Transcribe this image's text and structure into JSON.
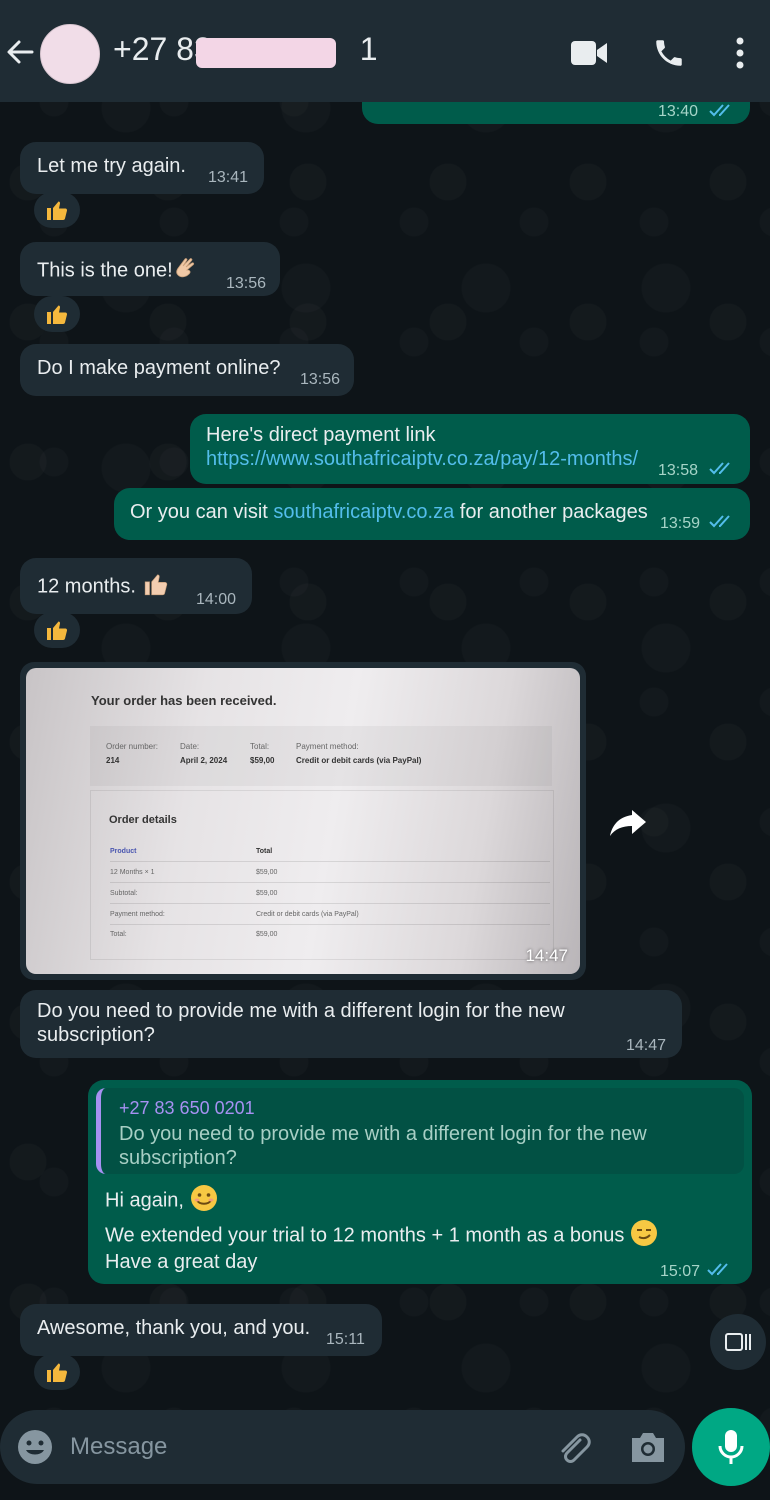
{
  "header": {
    "contact_name": "+27 83",
    "contact_suffix": "1"
  },
  "messages": {
    "m0_time": "13:40",
    "m1_text": "Let me try again.",
    "m1_time": "13:41",
    "m2_text": "This is the one!",
    "m2_time": "13:56",
    "m3_text": "Do I make payment online?",
    "m3_time": "13:56",
    "m4_line1": "Here's  direct payment link",
    "m4_link": "https://www.southafricaiptv.co.za/pay/12-months/",
    "m4_time": "13:58",
    "m5_pre": "Or you can visit ",
    "m5_link": "southafricaiptv.co.za",
    "m5_post": " for another packages",
    "m5_time": "13:59",
    "m6_text": "12 months.",
    "m6_time": "14:00",
    "m8_text": "Do you need to provide me with a different login for the new subscription?",
    "m8_time": "14:47",
    "m9_quote_name": "+27 83 650 0201",
    "m9_quote_text": "Do you need to provide me with a different login for the new subscription?",
    "m9_line1": "Hi again,",
    "m9_line2": "We extended your trial to 12 months + 1 month as a bonus",
    "m9_line3": "Have a great day",
    "m9_time": "15:07",
    "m10_text": "Awesome, thank you, and you.",
    "m10_time": "15:11"
  },
  "image_message": {
    "time": "14:47",
    "order_title": "Your order has been received.",
    "order_number_label": "Order number:",
    "order_number": "214",
    "date_label": "Date:",
    "date": "April 2, 2024",
    "total_label": "Total:",
    "total": "$59,00",
    "payment_method_label": "Payment method:",
    "payment_method": "Credit or debit cards (via PayPal)",
    "order_details": "Order details",
    "col_product": "Product",
    "col_total": "Total",
    "row1_label": "12 Months × 1",
    "row1_value": "$59,00",
    "row2_label": "Subtotal:",
    "row2_value": "$59,00",
    "row3_label": "Payment method:",
    "row3_value": "Credit or debit cards (via PayPal)",
    "row4_label": "Total:",
    "row4_value": "$59,00"
  },
  "composer": {
    "placeholder": "Message"
  },
  "reaction_emoji": "thumbs-up",
  "colors": {
    "incoming_bubble": "#1f2c34",
    "outgoing_bubble": "#005c4b",
    "link": "#53bdeb",
    "read_ticks": "#53bdeb",
    "accent": "#00a884",
    "quote_accent": "#a791f2"
  },
  "icons": [
    "back-arrow-icon",
    "video-call-icon",
    "phone-icon",
    "more-vert-icon",
    "forward-icon",
    "emoji-icon",
    "attach-icon",
    "camera-icon",
    "mic-icon",
    "scroll-down-icon"
  ]
}
